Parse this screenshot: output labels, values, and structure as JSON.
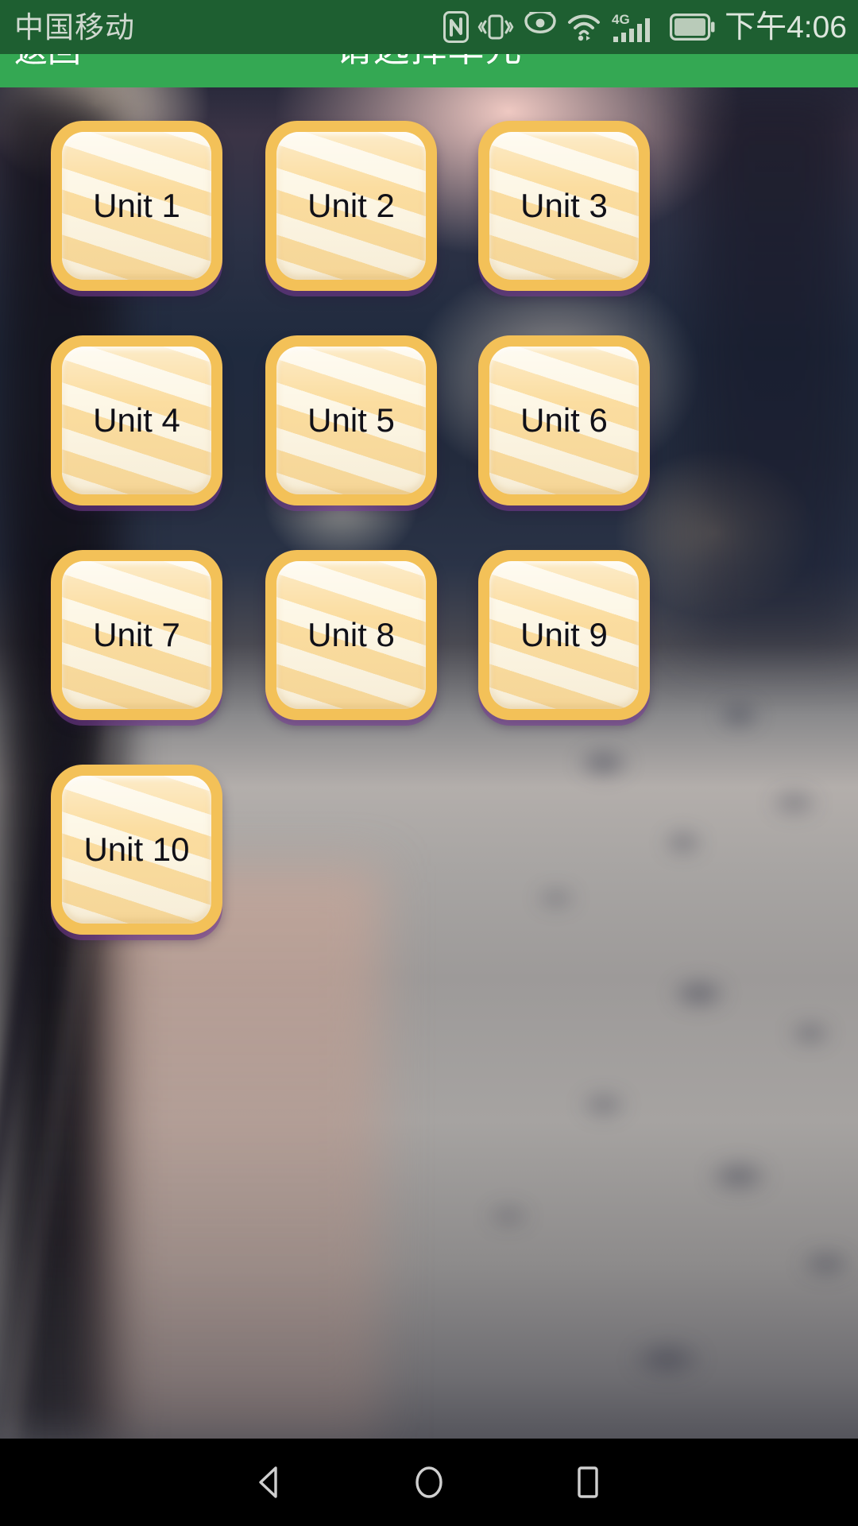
{
  "status_bar": {
    "carrier": "中国移动",
    "time": "下午4:06",
    "icons": [
      {
        "name": "nfc-icon",
        "label": "NFC"
      },
      {
        "name": "vibrate-icon",
        "label": "Vibrate"
      },
      {
        "name": "eye-comfort-icon",
        "label": "Eye comfort"
      },
      {
        "name": "wifi-icon",
        "label": "Wi-Fi"
      },
      {
        "name": "signal-4g-icon",
        "label": "4G"
      },
      {
        "name": "battery-icon",
        "label": "Battery"
      }
    ],
    "network_type": "4G",
    "background_color": "#1e5f31",
    "text_color": "#cfd8cf"
  },
  "title_bar": {
    "back_label": "返回",
    "title": "请选择单元",
    "background_color": "#34a853",
    "text_color": "#ffffff"
  },
  "units": {
    "columns": 3,
    "items": [
      {
        "label": "Unit 1"
      },
      {
        "label": "Unit 2"
      },
      {
        "label": "Unit 3"
      },
      {
        "label": "Unit 4"
      },
      {
        "label": "Unit 5"
      },
      {
        "label": "Unit 6"
      },
      {
        "label": "Unit 7"
      },
      {
        "label": "Unit 8"
      },
      {
        "label": "Unit 9"
      },
      {
        "label": "Unit 10"
      }
    ],
    "border_color": "#f3c158",
    "face_color": "#fdf7e6",
    "stripe_color": "#fbdda0",
    "shadow_color": "#7a3c96",
    "label_color": "#101018"
  },
  "nav_bar": {
    "background_color": "#000000",
    "buttons": [
      {
        "name": "nav-back-button",
        "label": "Back"
      },
      {
        "name": "nav-home-button",
        "label": "Home"
      },
      {
        "name": "nav-recents-button",
        "label": "Recents"
      }
    ]
  }
}
